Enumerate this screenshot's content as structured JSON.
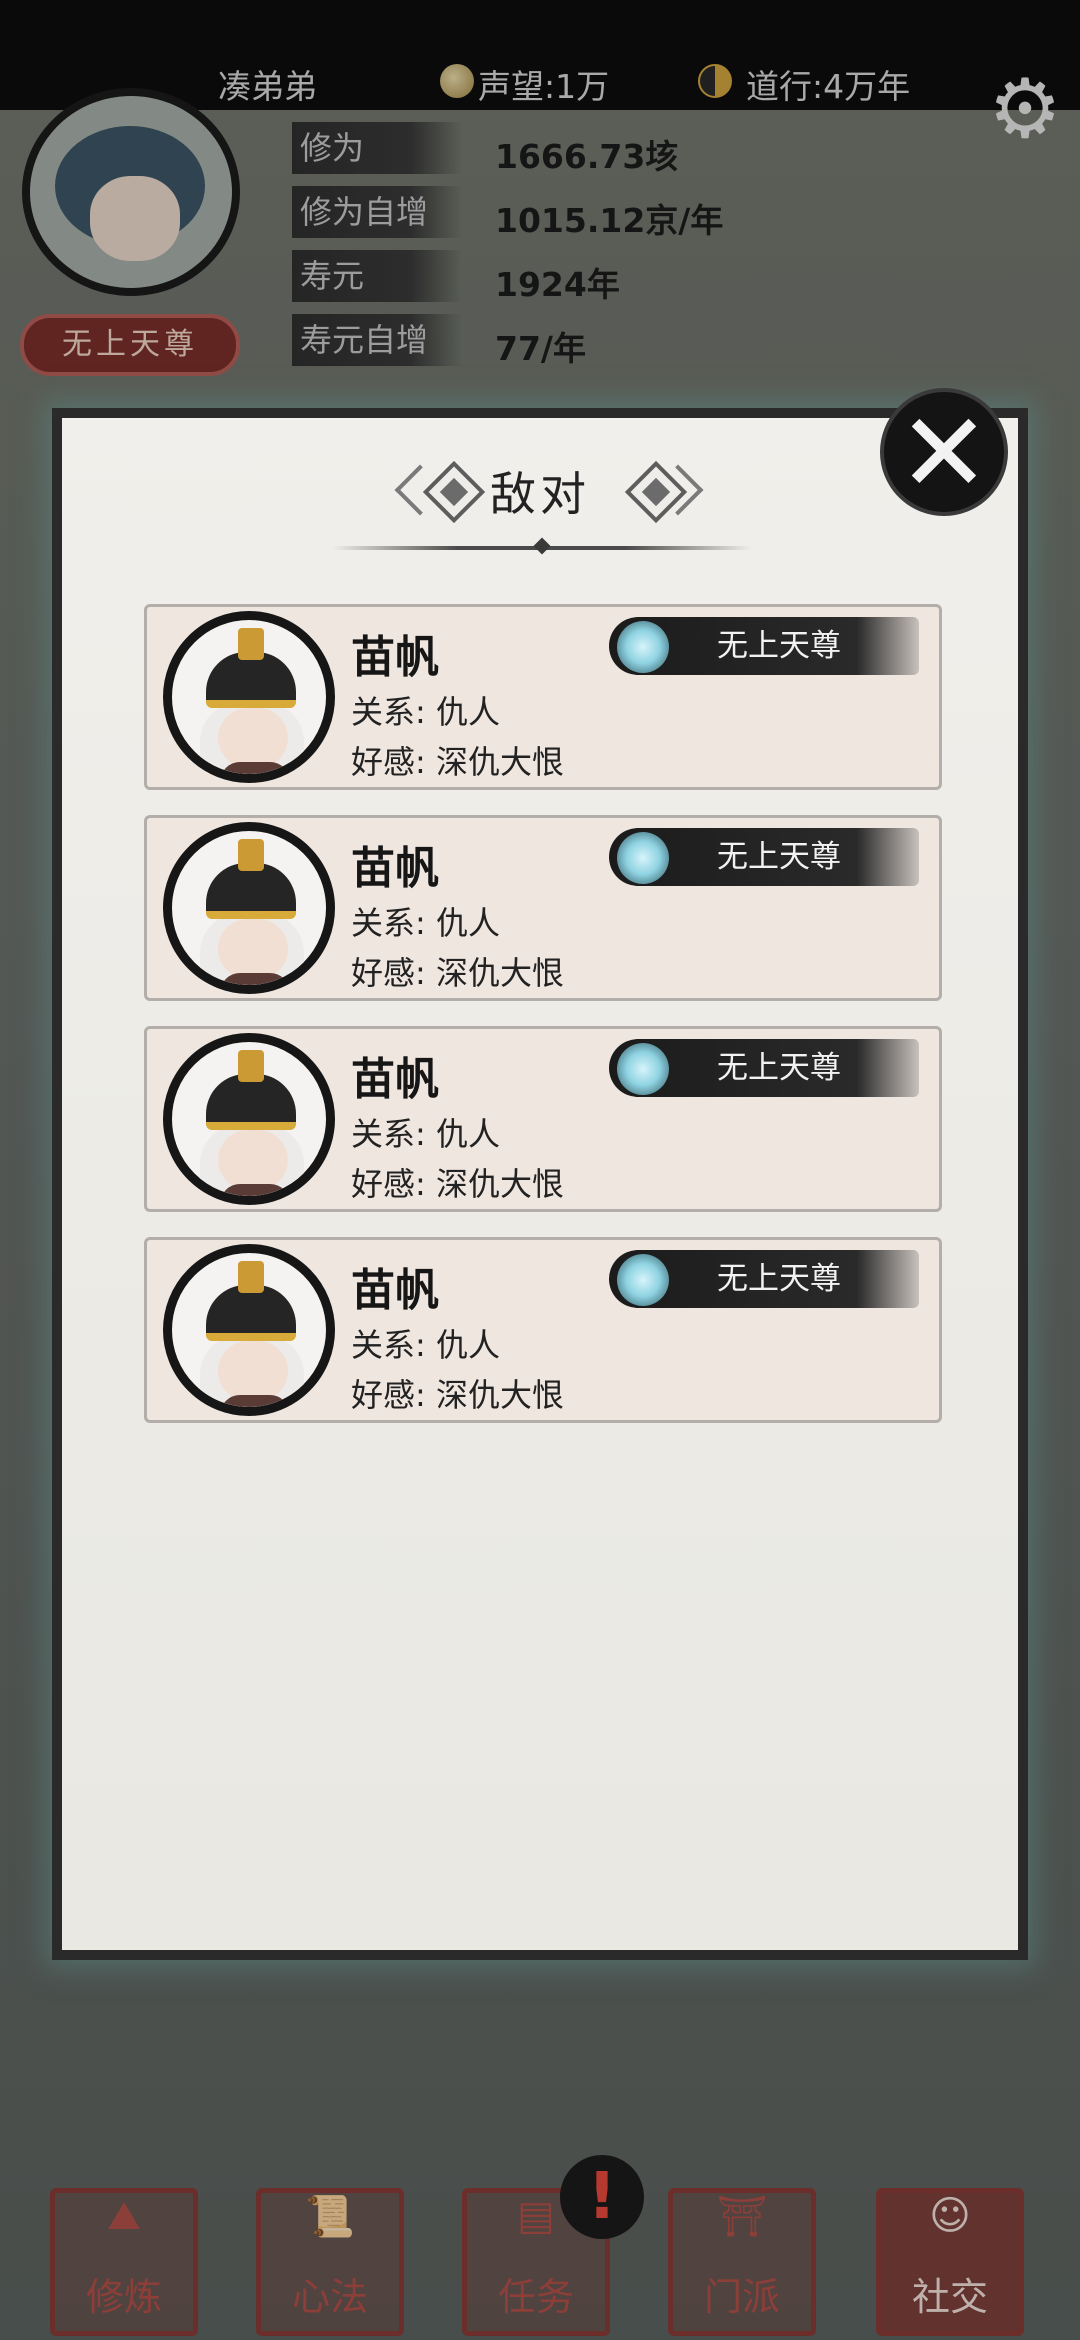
{
  "player": {
    "name": "凑弟弟",
    "reputation": "声望:1万",
    "dao_practice": "道行:4万年",
    "title": "无上天尊"
  },
  "stats": [
    {
      "label": "修为",
      "value": "1666.73垓"
    },
    {
      "label": "修为自增",
      "value": "1015.12京/年"
    },
    {
      "label": "寿元",
      "value": "1924年"
    },
    {
      "label": "寿元自增",
      "value": "77/年"
    }
  ],
  "dialog": {
    "title": "敌对",
    "close_label": "✕",
    "entries": [
      {
        "name": "苗帆",
        "relation": "关系:  仇人",
        "favor": "好感:  深仇大恨",
        "rank": "无上天尊"
      },
      {
        "name": "苗帆",
        "relation": "关系:  仇人",
        "favor": "好感:  深仇大恨",
        "rank": "无上天尊"
      },
      {
        "name": "苗帆",
        "relation": "关系:  仇人",
        "favor": "好感:  深仇大恨",
        "rank": "无上天尊"
      },
      {
        "name": "苗帆",
        "relation": "关系:  仇人",
        "favor": "好感:  深仇大恨",
        "rank": "无上天尊"
      }
    ]
  },
  "nav": [
    {
      "label": "修炼",
      "icon": "cultivate-icon"
    },
    {
      "label": "心法",
      "icon": "scroll-icon"
    },
    {
      "label": "任务",
      "icon": "task-icon"
    },
    {
      "label": "门派",
      "icon": "sect-icon"
    },
    {
      "label": "社交",
      "icon": "social-icon"
    }
  ],
  "colors": {
    "dialog_bg": "#ecebe6",
    "card_bg": "#efe6e0",
    "nav_red": "#8a3b36"
  }
}
